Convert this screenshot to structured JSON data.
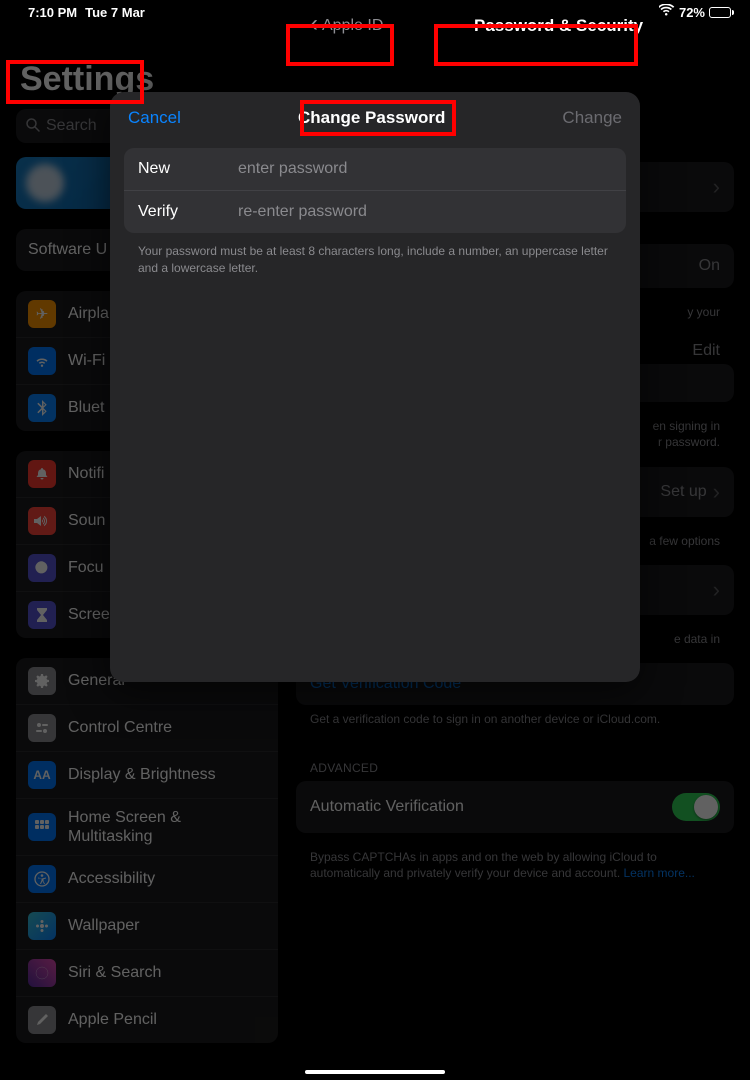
{
  "status": {
    "time": "7:10 PM",
    "date": "Tue 7 Mar",
    "battery": "72%"
  },
  "header": {
    "back": "Apple ID",
    "title": "Password & Security"
  },
  "sidebar": {
    "title": "Settings",
    "searchPlaceholder": "Search",
    "softwareUpdate": "Software U",
    "items1": [
      {
        "label": "Airpla"
      },
      {
        "label": "Wi-Fi"
      },
      {
        "label": "Bluet"
      }
    ],
    "items2": [
      {
        "label": "Notifi"
      },
      {
        "label": "Soun"
      },
      {
        "label": "Focu"
      },
      {
        "label": "Scree"
      }
    ],
    "items3": [
      {
        "label": "General"
      },
      {
        "label": "Control Centre"
      },
      {
        "label": "Display & Brightness"
      },
      {
        "label": "Home Screen & Multitasking"
      },
      {
        "label": "Accessibility"
      },
      {
        "label": "Wallpaper"
      },
      {
        "label": "Siri & Search"
      },
      {
        "label": "Apple Pencil"
      }
    ]
  },
  "main": {
    "twoFactor": {
      "value": "On"
    },
    "twoFactorCaption": "y your",
    "editLabel": "Edit",
    "signinCaption": "en signing in\nr password.",
    "setup": {
      "label": "Set up"
    },
    "setupCaption": "a few options",
    "advDataCaption": "e data in",
    "verifLink": "Get Verification Code",
    "verifCaption": "Get a verification code to sign in on another device or iCloud.com.",
    "advancedHeader": "ADVANCED",
    "autoVerif": {
      "label": "Automatic Verification"
    },
    "autoVerifCaption": "Bypass CAPTCHAs in apps and on the web by allowing iCloud to automatically and privately verify your device and account. ",
    "learnMore": "Learn more..."
  },
  "modal": {
    "cancel": "Cancel",
    "title": "Change Password",
    "change": "Change",
    "newLabel": "New",
    "newPlaceholder": "enter password",
    "verifyLabel": "Verify",
    "verifyPlaceholder": "re-enter password",
    "hint": "Your password must be at least 8 characters long, include a number, an uppercase letter and a lowercase letter."
  }
}
